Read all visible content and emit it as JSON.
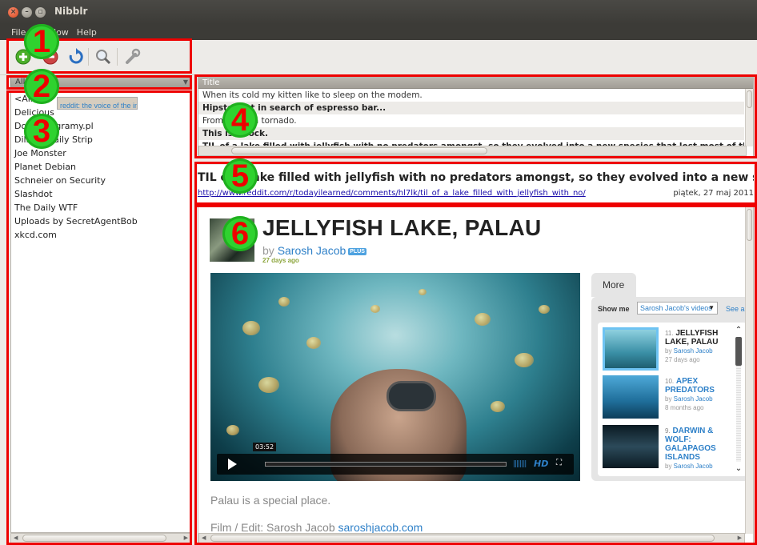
{
  "window": {
    "title": "Nibblr"
  },
  "menu": [
    "File",
    "Window",
    "Help"
  ],
  "toolbar": {
    "add_icon": "add-circle-icon",
    "refresh_icon": "refresh-icon",
    "search_icon": "magnifier-icon",
    "settings_icon": "wrench-icon"
  },
  "source_combo": {
    "value": "All"
  },
  "feeds": [
    "<All>",
    "Delicious",
    "Dobreprogramy.pl",
    "Dilbert Daily Strip",
    "Joe Monster",
    "Planet Debian",
    "Schneier on Security",
    "Slashdot",
    "The Daily WTF",
    "Uploads by SecretAgentBob",
    "reddit: the voice of the internet -- news before it happens",
    "xkcd.com"
  ],
  "selected_feed_index": 10,
  "items_header": "Title",
  "items": [
    {
      "title": "When its cold my kitten like to sleep on the modem.",
      "unread": false
    },
    {
      "title": "Hipster cat in search of espresso bar...",
      "unread": true
    },
    {
      "title": "From inside a tornado.",
      "unread": false
    },
    {
      "title": "This is a rock.",
      "unread": true
    },
    {
      "title": "TIL of a lake filled with jellyfish with no predators amongst, so they evolved into a new species that lost most of their stinging ability",
      "unread": true
    }
  ],
  "article": {
    "title": "TIL of a lake filled with jellyfish with no predators amongst, so they evolved into a new species that lost most of their stinging ability",
    "link": "http://www.reddit.com/r/todayilearned/comments/hl7lk/til_of_a_lake_filled_with_jellyfish_with_no/",
    "date": "piątek, 27 maj 2011"
  },
  "video": {
    "title": "JELLYFISH LAKE, PALAU",
    "by_prefix": "by ",
    "author": "Sarosh Jacob",
    "plus_badge": "PLUS",
    "age": "27 days ago",
    "time": "03:52",
    "hd": "HD",
    "desc1": "Palau is a special place.",
    "desc2_prefix": "Film / Edit: Sarosh Jacob ",
    "desc2_link": "saroshjacob.com"
  },
  "more": {
    "tab": "More",
    "show_me": "Show me",
    "select_value": "Sarosh Jacob's videos",
    "see_all": "See all",
    "videos": [
      {
        "num": "11.",
        "title": "JELLYFISH LAKE, PALAU",
        "by": "by ",
        "author": "Sarosh Jacob",
        "age": "27 days ago"
      },
      {
        "num": "10.",
        "title": "APEX PREDATORS",
        "by": "by ",
        "author": "Sarosh Jacob",
        "age": "8 months ago"
      },
      {
        "num": "9.",
        "title": "DARWIN & WOLF: GALAPAGOS ISLANDS",
        "by": "by ",
        "author": "Sarosh Jacob",
        "age": ""
      }
    ]
  },
  "annotations": [
    "1",
    "2",
    "3",
    "4",
    "5",
    "6"
  ],
  "colors": {
    "annotation_border": "#ee0000",
    "badge_fill": "#2fd22f",
    "link": "#2e80c8",
    "selected_row": "#d6cdbf"
  }
}
